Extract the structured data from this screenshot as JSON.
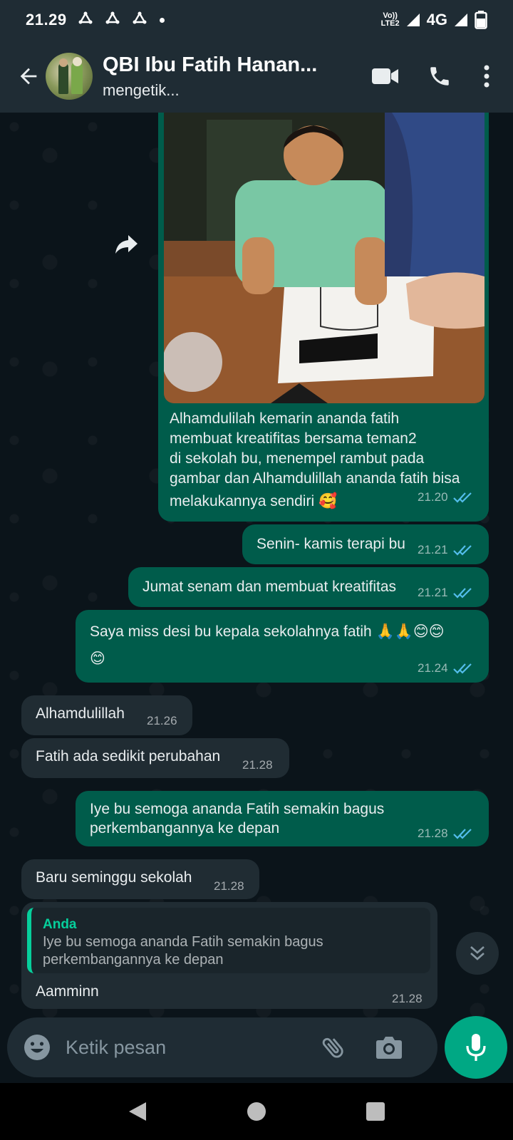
{
  "status_bar": {
    "time": "21.29",
    "volte_top": "Vo))",
    "volte_bottom": "LTE2",
    "network": "4G"
  },
  "header": {
    "title": "QBI Ibu Fatih Hanan...",
    "subtitle": "mengetik..."
  },
  "messages": [
    {
      "direction": "out",
      "text_lines": [
        "Alhamdulilah kemarin ananda fatih",
        "membuat kreatifitas bersama teman2",
        "di sekolah bu, menempel rambut pada",
        "gambar dan Alhamdulillah ananda fatih bisa",
        "melakukannya sendiri 🥰"
      ],
      "time": "21.20",
      "status": "read"
    },
    {
      "direction": "out",
      "text": "Senin- kamis terapi bu",
      "time": "21.21",
      "status": "read"
    },
    {
      "direction": "out",
      "text": "Jumat senam dan membuat kreatifitas",
      "time": "21.21",
      "status": "read"
    },
    {
      "direction": "out",
      "text_lines": [
        "Saya miss desi bu kepala sekolahnya fatih 🙏🙏😊😊",
        "😊"
      ],
      "time": "21.24",
      "status": "read"
    },
    {
      "direction": "in",
      "text": "Alhamdulillah",
      "time": "21.26"
    },
    {
      "direction": "in",
      "text": "Fatih ada sedikit perubahan",
      "time": "21.28"
    },
    {
      "direction": "out",
      "text_lines": [
        "Iye bu semoga ananda Fatih semakin bagus",
        "perkembangannya ke depan"
      ],
      "time": "21.28",
      "status": "read"
    },
    {
      "direction": "in",
      "text": "Baru seminggu sekolah",
      "time": "21.28"
    },
    {
      "direction": "in",
      "quote_author": "Anda",
      "quote_lines": [
        "Iye bu semoga ananda Fatih semakin bagus",
        "perkembangannya ke depan"
      ],
      "text": "Aamminn",
      "time": "21.28"
    }
  ],
  "composer": {
    "placeholder": "Ketik pesan"
  },
  "colors": {
    "header_bg": "#1f2c34",
    "chat_bg": "#0b141a",
    "outgoing_bubble": "#005c4b",
    "incoming_bubble": "#202c33",
    "accent": "#00a884",
    "read_tick": "#53bdeb"
  },
  "icons": {
    "back": "arrow-left-icon",
    "video": "video-camera-icon",
    "call": "phone-icon",
    "menu": "more-vert-icon",
    "forward": "forward-icon",
    "emoji": "emoji-icon",
    "attach": "paperclip-icon",
    "camera": "camera-icon",
    "mic": "mic-icon",
    "scroll": "double-chevron-down-icon"
  }
}
